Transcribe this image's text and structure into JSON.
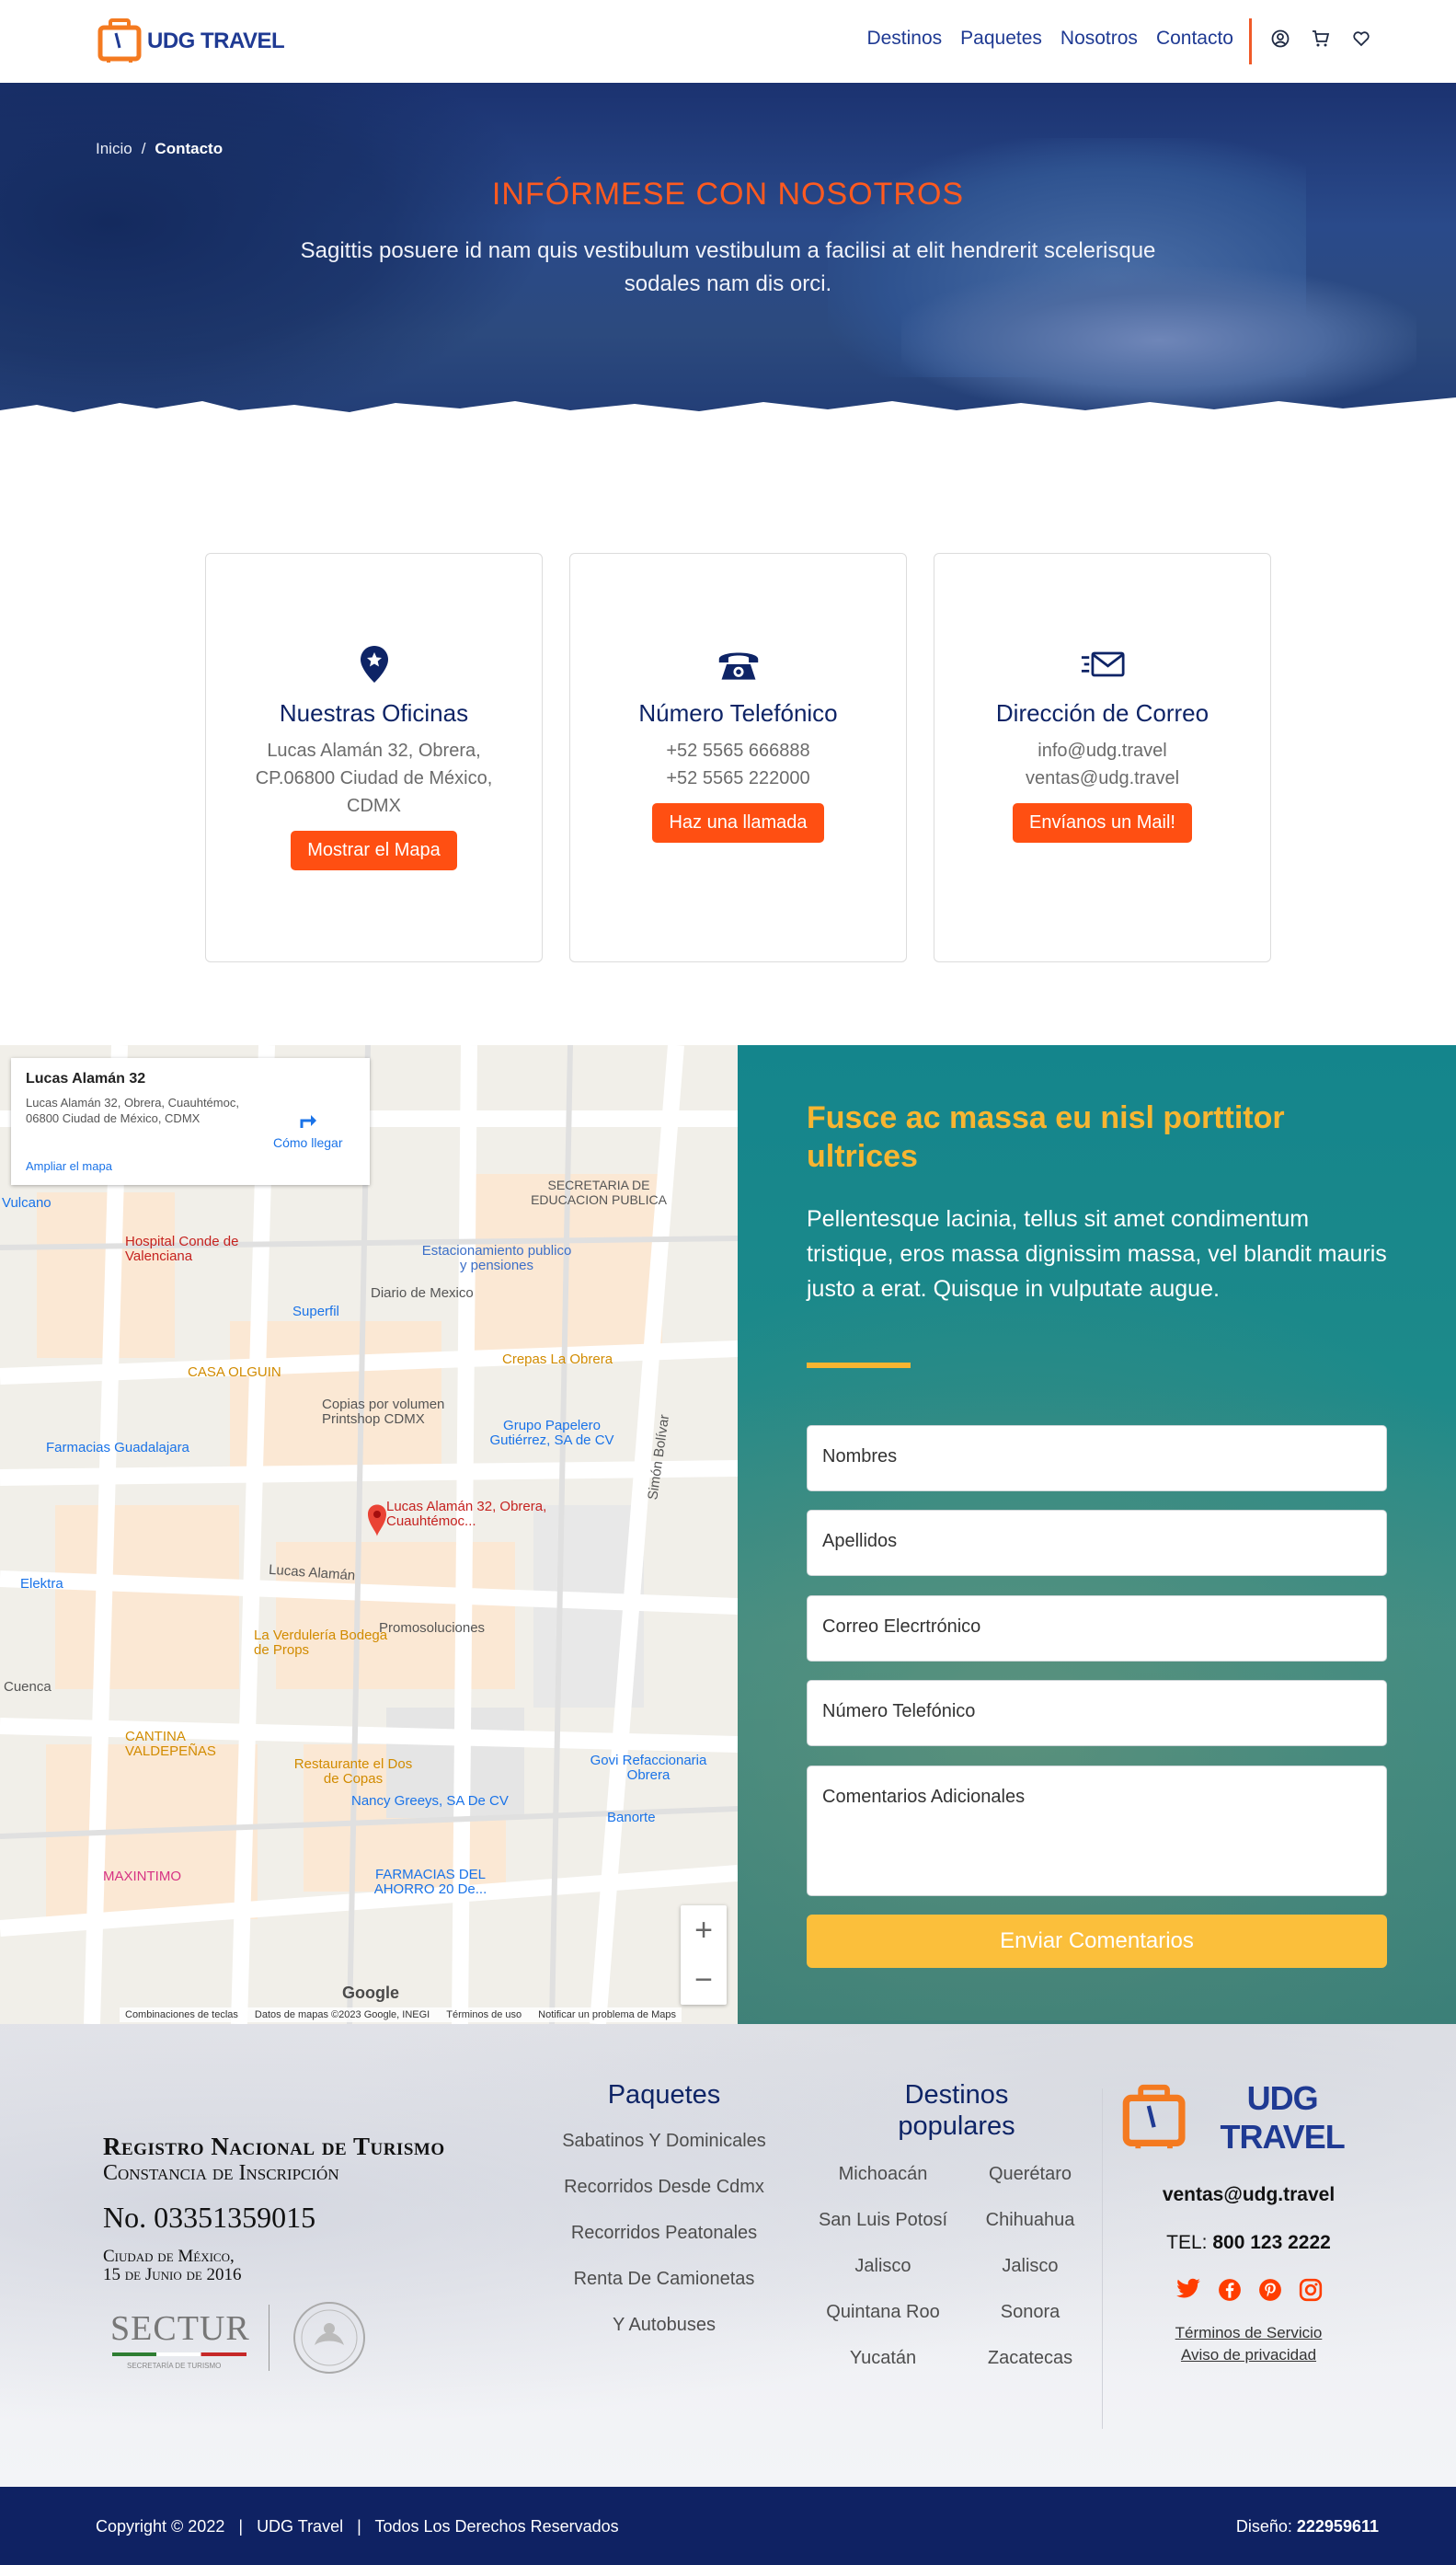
{
  "header": {
    "logo_text": "UDG TRAVEL",
    "nav": [
      "Destinos",
      "Paquetes",
      "Nosotros",
      "Contacto"
    ],
    "icons": [
      "user-icon",
      "cart-icon",
      "heart-icon"
    ]
  },
  "hero": {
    "breadcrumb": [
      "Inicio",
      "Contacto"
    ],
    "title": "INFÓRMESE CON NOSOTROS",
    "subtitle": "Sagittis posuere id nam quis vestibulum vestibulum a facilisi at elit hendrerit scelerisque sodales nam dis orci."
  },
  "cards": [
    {
      "icon": "location-pin-icon",
      "title": "Nuestras Oficinas",
      "lines": [
        "Lucas Alamán 32, Obrera,",
        "CP.06800 Ciudad de México,",
        "CDMX"
      ],
      "button": "Mostrar el Mapa"
    },
    {
      "icon": "telephone-icon",
      "title": "Número Telefónico",
      "lines": [
        "+52 5565 666888",
        "+52 5565 222000"
      ],
      "button": "Haz una llamada"
    },
    {
      "icon": "mail-send-icon",
      "title": "Dirección de Correo",
      "lines": [
        "info@udg.travel",
        "ventas@udg.travel"
      ],
      "button": "Envíanos un Mail!"
    }
  ],
  "map": {
    "info_title": "Lucas Alamán 32",
    "info_address": "Lucas Alamán 32, Obrera, Cuauhtémoc, 06800 Ciudad de México, CDMX",
    "directions": "Cómo llegar",
    "enlarge": "Ampliar el mapa",
    "labels": [
      "SECRETARIA DE EDUCACION PUBLICA",
      "Hospital Conde de Valenciana",
      "Estacionamiento publico y pensiones",
      "Diario de Mexico",
      "Superfil",
      "Crepas La Obrera",
      "CASA OLGUIN",
      "Copias por volumen Printshop CDMX",
      "Farmacias Guadalajara",
      "Grupo Papelero Gutiérrez, SA de CV",
      "Lucas Alamán 32, Obrera, Cuauhtémoc...",
      "Elektra",
      "Lucas Alamán",
      "La Verdulería Bodega de Props",
      "Promosoluciones",
      "Cuenca",
      "CANTINA VALDEPEÑAS",
      "Restaurante el Dos de Copas",
      "Nancy Greeys, SA De CV",
      "Govi Refaccionaria Obrera",
      "FARMACIAS DEL AHORRO 20 De...",
      "MAXINTIMO",
      "Vulcano",
      "Simón Bolívar",
      "Banorte"
    ],
    "footer_links": [
      "Combinaciones de teclas",
      "Datos de mapas ©2023 Google, INEGI",
      "Términos de uso",
      "Notificar un problema de Maps"
    ],
    "google": "Google"
  },
  "form": {
    "title": "Fusce ac massa eu nisl porttitor ultrices",
    "text": "Pellentesque lacinia, tellus sit amet condimentum tristique, eros massa dignissim massa, vel blandit mauris justo a erat. Quisque in vulputate augue.",
    "fields": [
      "Nombres",
      "Apellidos",
      "Correo Elecrtrónico",
      "Número Telefónico",
      "Comentarios Adicionales"
    ],
    "submit": "Enviar Comentarios"
  },
  "footer": {
    "reg_title": "Registro Nacional de Turismo",
    "reg_sub": "Constancia de Inscripción",
    "reg_no": "No. 03351359015",
    "reg_city": "Ciudad de México,",
    "reg_date": "15 de Junio de 2016",
    "sectur": "SECTUR",
    "sectur_sub": "SECRETARÍA DE TURISMO",
    "paquetes_title": "Paquetes",
    "paquetes": [
      "Sabatinos Y Dominicales",
      "Recorridos Desde Cdmx",
      "Recorridos Peatonales",
      "Renta De Camionetas",
      "Y Autobuses"
    ],
    "destinos_title": "Destinos populares",
    "destinos": [
      "Michoacán",
      "Querétaro",
      "San Luis Potosí",
      "Chihuahua",
      "Jalisco",
      "Jalisco",
      "Quintana Roo",
      "Sonora",
      "Yucatán",
      "Zacatecas"
    ],
    "email": "ventas@udg.travel",
    "tel_label": "TEL:",
    "tel": "800 123 2222",
    "socials": [
      "twitter-icon",
      "facebook-icon",
      "pinterest-icon",
      "instagram-icon"
    ],
    "terms": "Términos de Servicio",
    "privacy": "Aviso de privacidad"
  },
  "bottom": {
    "copyright": "Copyright © 2022",
    "brand": "UDG Travel",
    "rights": "Todos Los Derechos Reservados",
    "design_label": "Diseño:",
    "design_value": "222959611"
  },
  "colors": {
    "navy": "#0f2263",
    "orange": "#ff4f12",
    "yellow": "#f7b531",
    "teal": "#14858c"
  }
}
